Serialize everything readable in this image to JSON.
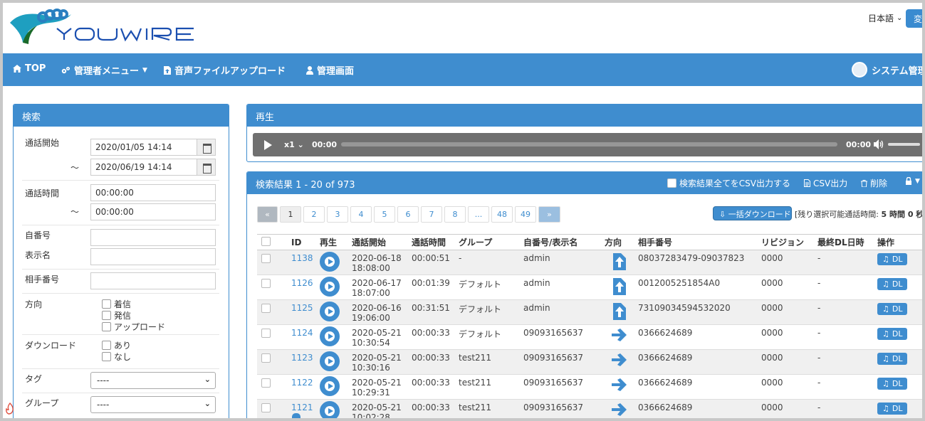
{
  "header": {
    "language": "日本語",
    "change_button": "変"
  },
  "nav": {
    "items": [
      {
        "label": "TOP",
        "icon": "home-icon"
      },
      {
        "label": "管理者メニュー",
        "icon": "gears-icon"
      },
      {
        "label": "音声ファイルアップロード",
        "icon": "file-upload-icon"
      },
      {
        "label": "管理画面",
        "icon": "user-icon"
      }
    ],
    "user": "システム管理"
  },
  "search": {
    "title": "検索",
    "call_start_label": "通話開始",
    "call_start_from": "2020/01/05 14:14",
    "tilde": "～",
    "call_start_to": "2020/06/19 14:14",
    "duration_label": "通話時間",
    "duration_from": "00:00:00",
    "duration_to": "00:00:00",
    "own_number_label": "自番号",
    "display_name_label": "表示名",
    "partner_number_label": "相手番号",
    "direction_label": "方向",
    "direction_options": [
      "着信",
      "発信",
      "アップロード"
    ],
    "download_label": "ダウンロード",
    "download_options": [
      "あり",
      "なし"
    ],
    "tag_label": "タグ",
    "tag_value": "----",
    "group_label": "グループ",
    "group_value": "----"
  },
  "player": {
    "title": "再生",
    "speed": "x1",
    "current_time": "00:00",
    "end_time": "00:00"
  },
  "results": {
    "title": "検索結果 1 - 20 of 973",
    "csv_all_label": "検索結果全てをCSV出力する",
    "csv_label": "CSV出力",
    "delete_label": "削除",
    "pages": [
      "«",
      "1",
      "2",
      "3",
      "4",
      "5",
      "6",
      "7",
      "8",
      "...",
      "48",
      "49",
      "»"
    ],
    "bulk_download": "一括ダウンロード",
    "remaining_prefix": "[残り選択可能通話時間: ",
    "remaining_value": "5 時間 0 秒",
    "remaining_suffix": " ]",
    "columns": [
      "ID",
      "再生",
      "通話開始",
      "通話時間",
      "グループ",
      "自番号/表示名",
      "方向",
      "相手番号",
      "リビジョン",
      "最終DL日時",
      "操作"
    ],
    "dl_label": "DL",
    "rows": [
      {
        "id": "1138",
        "date": "2020-06-18",
        "time": "18:08:00",
        "duration": "00:00:51",
        "group": "-",
        "own": "admin",
        "direction": "upload",
        "partner": "08037283479-09037823",
        "revision": "0000",
        "last_dl": "-"
      },
      {
        "id": "1126",
        "date": "2020-06-17",
        "time": "18:07:00",
        "duration": "00:01:39",
        "group": "デフォルト",
        "own": "admin",
        "direction": "upload",
        "partner": "0012005251854A0",
        "revision": "0000",
        "last_dl": "-"
      },
      {
        "id": "1125",
        "date": "2020-06-16",
        "time": "19:06:00",
        "duration": "00:31:51",
        "group": "デフォルト",
        "own": "admin",
        "direction": "upload",
        "partner": "73109034594532020",
        "revision": "0000",
        "last_dl": "-"
      },
      {
        "id": "1124",
        "date": "2020-05-21",
        "time": "10:30:54",
        "duration": "00:00:33",
        "group": "デフォルト",
        "own": "09093165637",
        "direction": "outgoing",
        "partner": "0366624689",
        "revision": "0000",
        "last_dl": "-"
      },
      {
        "id": "1123",
        "date": "2020-05-21",
        "time": "10:30:16",
        "duration": "00:00:33",
        "group": "test211",
        "own": "09093165637",
        "direction": "outgoing",
        "partner": "0366624689",
        "revision": "0000",
        "last_dl": "-"
      },
      {
        "id": "1122",
        "date": "2020-05-21",
        "time": "10:29:31",
        "duration": "00:00:33",
        "group": "test211",
        "own": "09093165637",
        "direction": "outgoing",
        "partner": "0366624689",
        "revision": "0000",
        "last_dl": "-"
      },
      {
        "id": "1121",
        "date": "2020-05-21",
        "time": "10:02:28",
        "duration": "00:00:33",
        "group": "test211",
        "own": "09093165637",
        "direction": "outgoing",
        "partner": "0366624689",
        "revision": "0000",
        "last_dl": "-",
        "locked": true
      }
    ]
  },
  "colors": {
    "primary": "#3f8dcf",
    "player_bar": "#707070"
  }
}
